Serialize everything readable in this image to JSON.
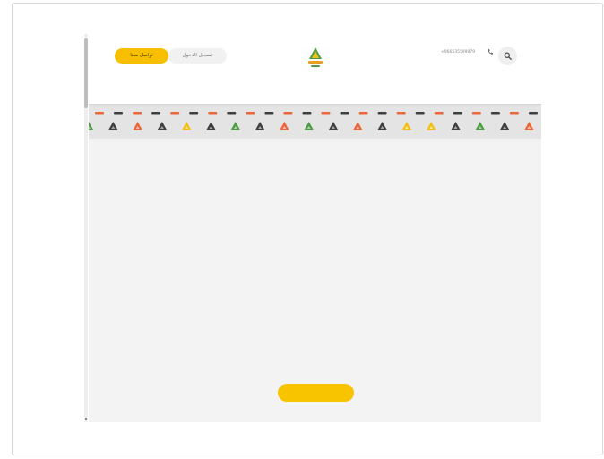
{
  "header": {
    "contact_button_label": "تواصل معنا",
    "login_button_label": "تسجيل الدخول",
    "phone_number": "+966535599079"
  },
  "icons": {
    "logo": "brand-logo-triangle",
    "phone": "phone-icon",
    "search": "search-icon",
    "decoration": "triangle-pattern"
  },
  "colors": {
    "accent": "#f7bf00",
    "pattern_orange": "#e9673a",
    "pattern_dark": "#3f3f3f",
    "pattern_green": "#4d9b45",
    "pattern_yellow": "#f2c012"
  },
  "pattern": {
    "triangles": [
      "green",
      "dark",
      "orange",
      "dark",
      "yellow",
      "dark",
      "green",
      "dark",
      "orange",
      "green",
      "dark",
      "orange",
      "dark",
      "yellow",
      "yellow",
      "dark",
      "green",
      "dark",
      "orange"
    ],
    "dashes": [
      "orange",
      "dark",
      "orange",
      "dark",
      "orange",
      "dark",
      "orange",
      "dark",
      "orange",
      "dark",
      "orange",
      "dark",
      "orange",
      "dark",
      "orange",
      "dark",
      "orange",
      "dark",
      "orange",
      "dark",
      "orange",
      "dark",
      "orange",
      "dark"
    ]
  },
  "main": {
    "cta_label": ""
  }
}
